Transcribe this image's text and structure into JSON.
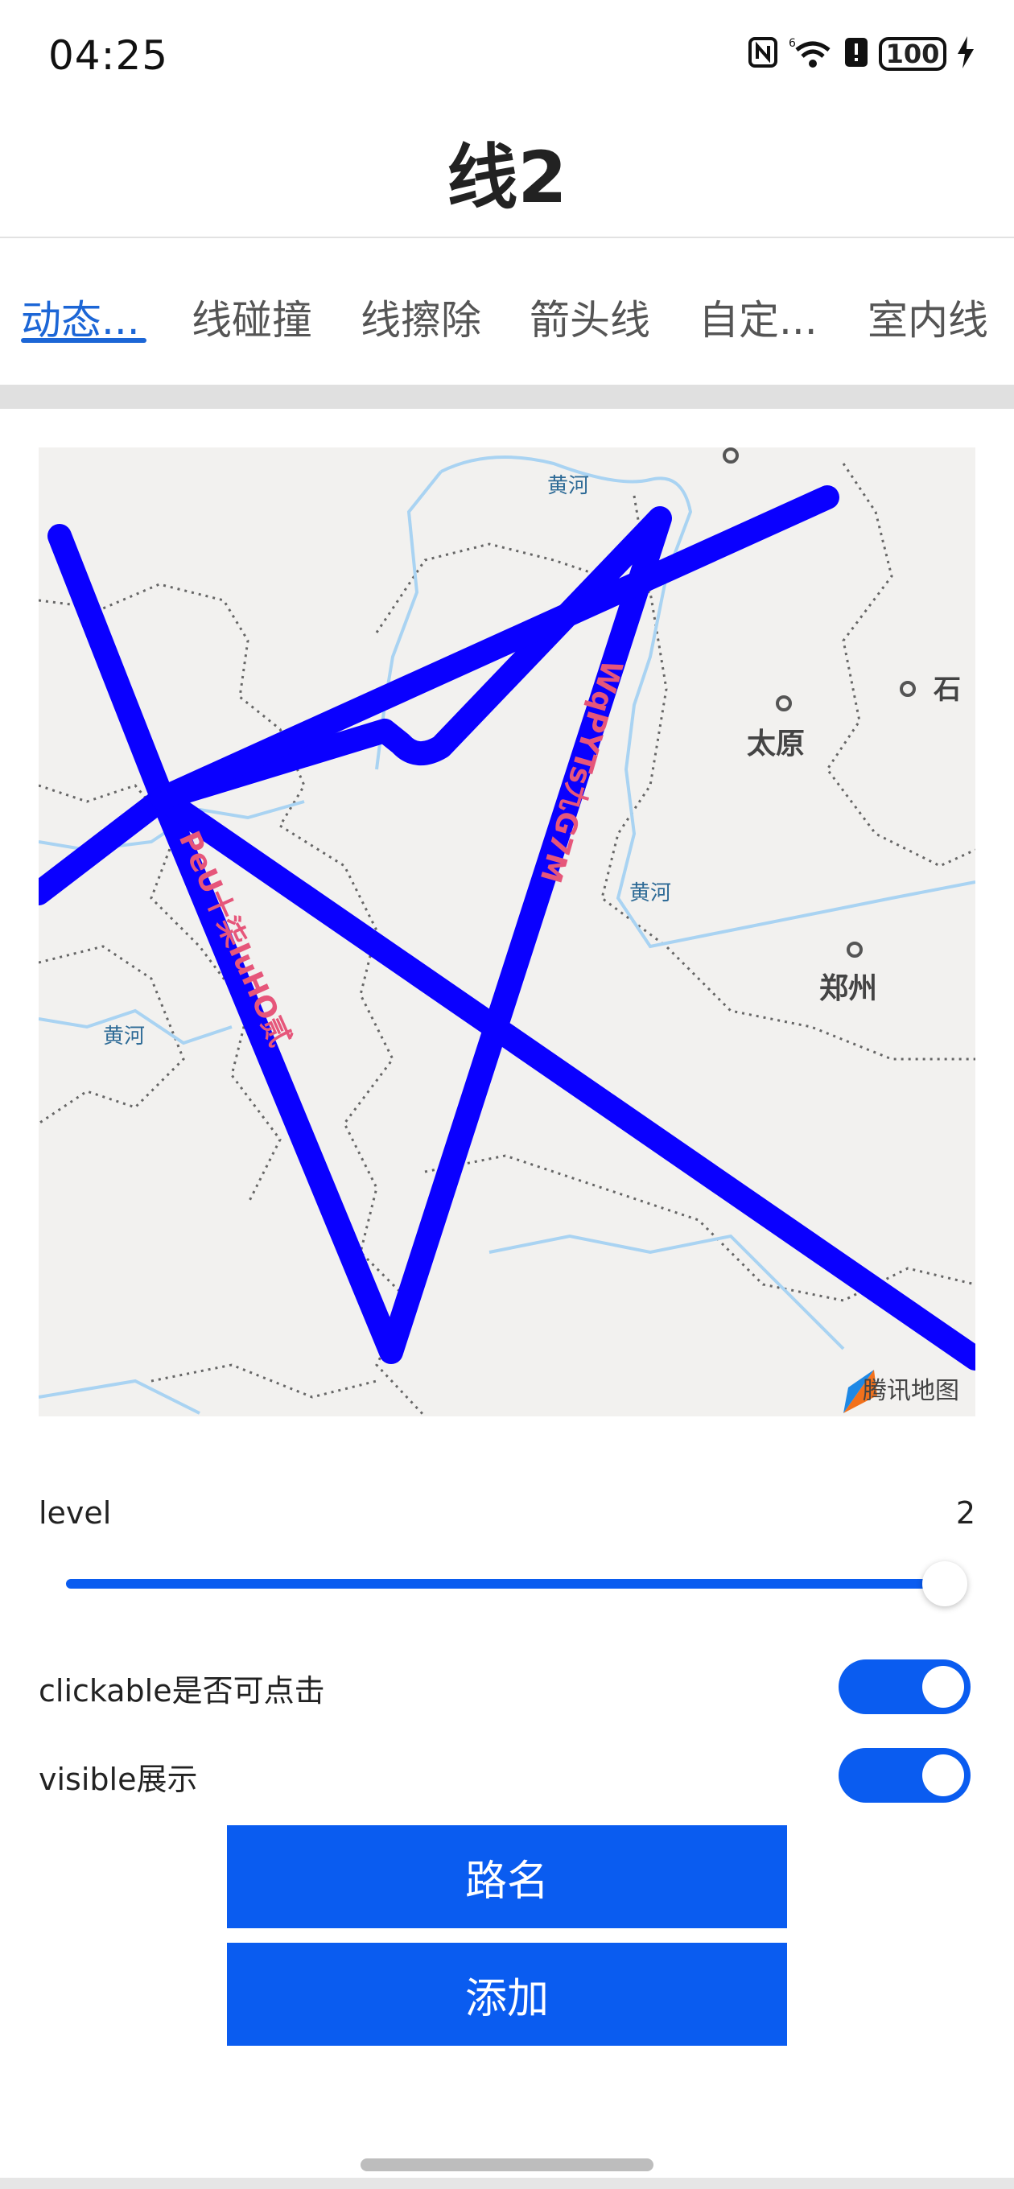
{
  "status_bar": {
    "time": "04:25",
    "battery": "100",
    "icons": [
      "nfc-icon",
      "wifi-icon",
      "alert-icon",
      "battery-icon",
      "charging-icon"
    ]
  },
  "header": {
    "title": "线2"
  },
  "tabs": [
    {
      "label": "动态...",
      "active": true
    },
    {
      "label": "线碰撞",
      "active": false
    },
    {
      "label": "线擦除",
      "active": false
    },
    {
      "label": "箭头线",
      "active": false
    },
    {
      "label": "自定...",
      "active": false
    },
    {
      "label": "室内线",
      "active": false
    }
  ],
  "map": {
    "labels": {
      "huanghe_top": "黄河",
      "taiyuan": "太原",
      "shi": "石",
      "huanghe_mid": "黄河",
      "zhengzhou": "郑州",
      "huanghe_left": "黄河"
    },
    "line_texts": {
      "left": "PeU十柒IuHO贰",
      "right": "WqPYTs九G7M"
    },
    "logo_text": "腾讯地图",
    "colors": {
      "line": "#0a00ff",
      "line_text": "#e6567a",
      "river": "#a9d3f2"
    }
  },
  "controls": {
    "level_label": "level",
    "level_value": "2",
    "level_fraction": 1.0,
    "clickable_label": "clickable是否可点击",
    "clickable_on": true,
    "visible_label": "visible展示",
    "visible_on": true
  },
  "buttons": {
    "road_name": "路名",
    "add": "添加"
  },
  "accent": "#0a5cf0"
}
